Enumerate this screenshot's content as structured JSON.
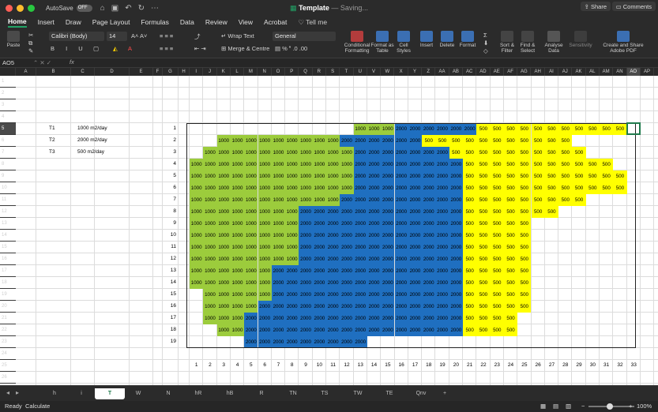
{
  "window": {
    "autosave_label": "AutoSave",
    "autosave_state": "OFF",
    "title": "Template",
    "saving": "— Saving...",
    "traffic": [
      "#ff5f57",
      "#febc2e",
      "#28c840"
    ]
  },
  "menu": {
    "tabs": [
      "Home",
      "Insert",
      "Draw",
      "Page Layout",
      "Formulas",
      "Data",
      "Review",
      "View",
      "Acrobat"
    ],
    "tell_me": "Tell me",
    "share": "Share",
    "comments": "Comments"
  },
  "ribbon": {
    "paste": "Paste",
    "font_name": "Calibri (Body)",
    "font_size": "14",
    "wrap_text": "Wrap Text",
    "merge_centre": "Merge & Centre",
    "number_format": "General",
    "conditional_formatting": "Conditional Formatting",
    "format_as_table": "Format as Table",
    "cell_styles": "Cell Styles",
    "insert": "Insert",
    "delete": "Delete",
    "format": "Format",
    "sort_filter": "Sort & Filter",
    "find_select": "Find & Select",
    "analyse_data": "Analyse Data",
    "sensitivity": "Sensitivity",
    "create_share_pdf": "Create and Share Adobe PDF"
  },
  "formula_bar": {
    "name_box": "AO5",
    "fx": "fx"
  },
  "columns": [
    "A",
    "B",
    "C",
    "D",
    "E",
    "F",
    "G",
    "H",
    "I",
    "J",
    "K",
    "L",
    "M",
    "N",
    "O",
    "P",
    "Q",
    "R",
    "S",
    "T",
    "U",
    "V",
    "W",
    "X",
    "Y",
    "Z",
    "AA",
    "AB",
    "AC",
    "AD",
    "AE",
    "AF",
    "AG",
    "AH",
    "AI",
    "AJ",
    "AK",
    "AL",
    "AM",
    "AN",
    "AO",
    "AP"
  ],
  "selected_column": "AO",
  "rows": [
    "1",
    "2",
    "3",
    "4",
    "5",
    "6",
    "7",
    "8",
    "9",
    "10",
    "11",
    "12",
    "13",
    "14",
    "15",
    "16",
    "17",
    "18",
    "19",
    "20",
    "21",
    "22",
    "23",
    "24",
    "25",
    "26"
  ],
  "legend": [
    {
      "label": "T1",
      "value": "1000 m2/day"
    },
    {
      "label": "T2",
      "value": "2000 m2/day"
    },
    {
      "label": "T3",
      "value": "500 m2/day"
    }
  ],
  "row_numbers": [
    "1",
    "2",
    "3",
    "4",
    "5",
    "6",
    "7",
    "8",
    "9",
    "10",
    "11",
    "12",
    "13",
    "14",
    "15",
    "16",
    "17",
    "18",
    "19"
  ],
  "col_numbers": [
    "1",
    "2",
    "3",
    "4",
    "5",
    "6",
    "7",
    "8",
    "9",
    "10",
    "11",
    "12",
    "13",
    "14",
    "15",
    "16",
    "17",
    "18",
    "19",
    "20",
    "21",
    "22",
    "23",
    "24",
    "25",
    "26",
    "27",
    "28",
    "29",
    "30",
    "31",
    "32",
    "33"
  ],
  "colors": {
    "T1": "#9ccc3c",
    "T2": "#1f6fc0",
    "T3": "#ffff00",
    "accent": "#21a366"
  },
  "schedule": [
    [
      13,
      3,
      6,
      11
    ],
    [
      3,
      9,
      6,
      11
    ],
    [
      2,
      11,
      7,
      10
    ],
    [
      1,
      12,
      8,
      11
    ],
    [
      1,
      12,
      8,
      12
    ],
    [
      1,
      12,
      8,
      12
    ],
    [
      1,
      11,
      9,
      9
    ],
    [
      1,
      8,
      12,
      7
    ],
    [
      1,
      8,
      12,
      5
    ],
    [
      1,
      8,
      12,
      5
    ],
    [
      1,
      8,
      12,
      5
    ],
    [
      1,
      8,
      12,
      5
    ],
    [
      1,
      6,
      14,
      5
    ],
    [
      1,
      6,
      14,
      5
    ],
    [
      2,
      5,
      14,
      5
    ],
    [
      2,
      4,
      15,
      5
    ],
    [
      2,
      3,
      16,
      4
    ],
    [
      3,
      2,
      16,
      4
    ],
    [
      5,
      0,
      9,
      0
    ]
  ],
  "values": {
    "T1": "1000",
    "T2": "2000",
    "T3": "500"
  },
  "sheet_tabs": [
    "h",
    "i",
    "T",
    "W",
    "N",
    "hR",
    "hB",
    "R",
    "TN",
    "TS",
    "TW",
    "TE",
    "Qnv"
  ],
  "active_sheet": "T",
  "status": {
    "ready": "Ready",
    "calculate": "Calculate",
    "zoom": "100%"
  }
}
